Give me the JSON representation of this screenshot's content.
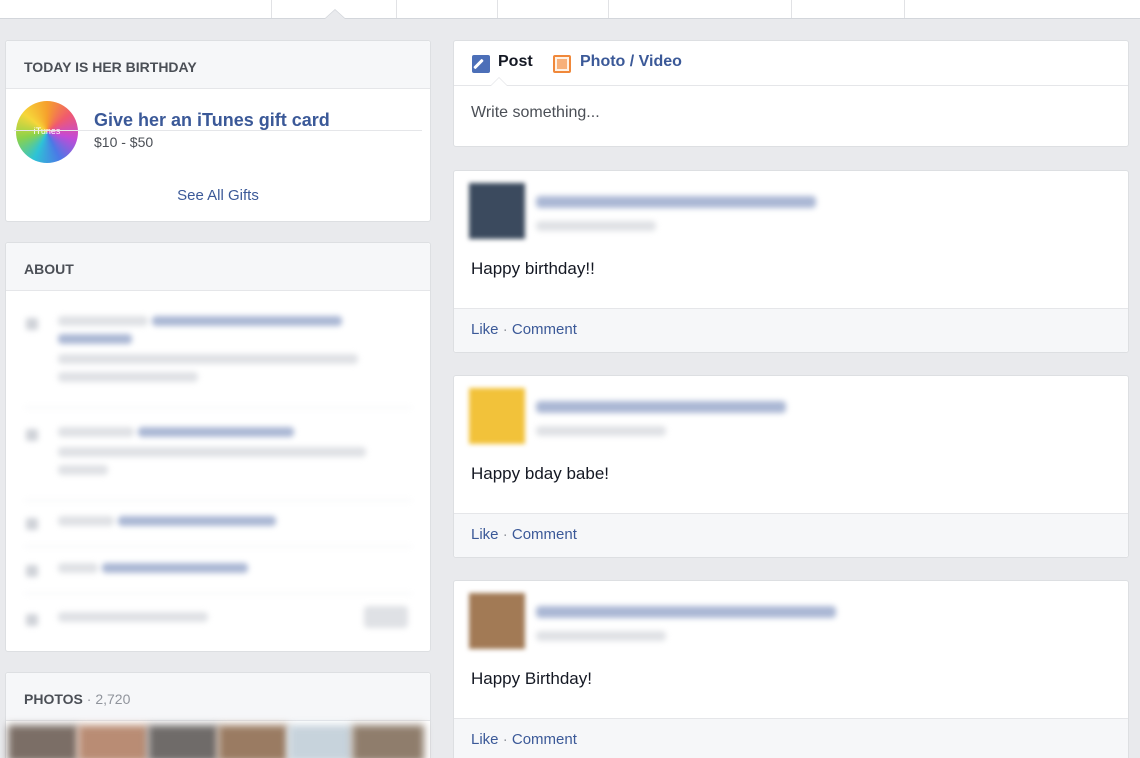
{
  "left_column": {
    "birthday_card": {
      "header": "TODAY IS HER BIRTHDAY",
      "gift_logo_text": "iTunes",
      "gift_title": "Give her an iTunes gift card",
      "gift_price": "$10 - $50",
      "see_all_label": "See All Gifts"
    },
    "about_card": {
      "header": "ABOUT"
    },
    "photos_card": {
      "header": "PHOTOS",
      "count": "2,720"
    }
  },
  "composer": {
    "tabs": [
      {
        "label": "Post",
        "icon": "pencil-icon"
      },
      {
        "label": "Photo / Video",
        "icon": "photo-icon"
      }
    ],
    "placeholder": "Write something..."
  },
  "posts": [
    {
      "text": "Happy birthday!!",
      "like_label": "Like",
      "separator": " · ",
      "comment_label": "Comment",
      "avatar_color": "#3b4a5e"
    },
    {
      "text": "Happy bday babe!",
      "like_label": "Like",
      "separator": " · ",
      "comment_label": "Comment",
      "avatar_color": "#f2c23a"
    },
    {
      "text": "Happy Birthday!",
      "like_label": "Like",
      "separator": " · ",
      "comment_label": "Comment",
      "avatar_color": "#a27a55"
    }
  ],
  "colors": {
    "link": "#3b5998",
    "background": "#e9eaed",
    "header_bg": "#f6f7f9"
  }
}
